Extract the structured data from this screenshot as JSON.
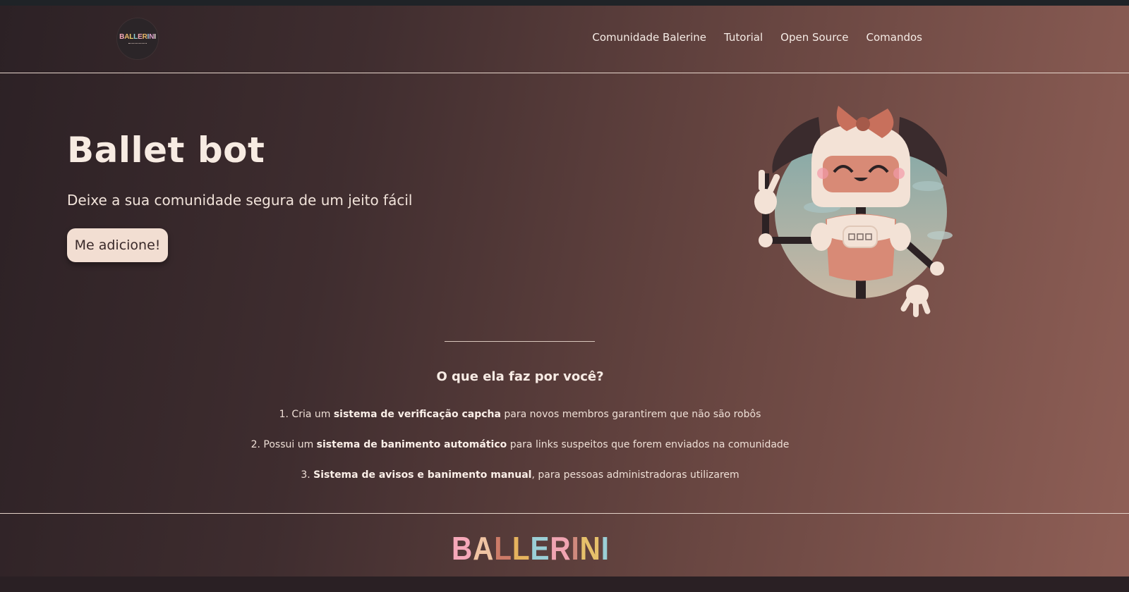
{
  "header": {
    "logo_letters": [
      "B",
      "A",
      "L",
      "L",
      "E",
      "R",
      "I",
      "N",
      "I"
    ],
    "nav": [
      "Comunidade Balerine",
      "Tutorial",
      "Open Source",
      "Comandos"
    ]
  },
  "hero": {
    "title": "Ballet bot",
    "subtitle": "Deixe a sua comunidade segura de um jeito fácil",
    "cta_label": "Me adicione!"
  },
  "features": {
    "title": "O que ela faz por você?",
    "items": [
      {
        "prefix": "1. Cria um ",
        "bold": "sistema de verificação capcha",
        "suffix": " para novos membros garantirem que não são robôs"
      },
      {
        "prefix": "2. Possui um ",
        "bold": "sistema de banimento automático",
        "suffix": " para links suspeitos que forem enviados na comunidade"
      },
      {
        "prefix": "3. ",
        "bold": "Sistema de avisos e banimento manual",
        "suffix": ", para pessoas administradoras utilizarem"
      }
    ]
  },
  "footer": {
    "wordmark_letters": [
      "B",
      "A",
      "L",
      "L",
      "E",
      "R",
      "I",
      "N",
      "I"
    ]
  },
  "colors": {
    "accent_button": "#f2ded2",
    "gradient_start": "#2c2125",
    "gradient_end": "#8f5f56",
    "robot_body": "#d88a76",
    "robot_face": "#f3e2d6"
  },
  "icons": {
    "logo": "ballerini-logo-icon",
    "robot": "ballerina-robot-illustration"
  }
}
